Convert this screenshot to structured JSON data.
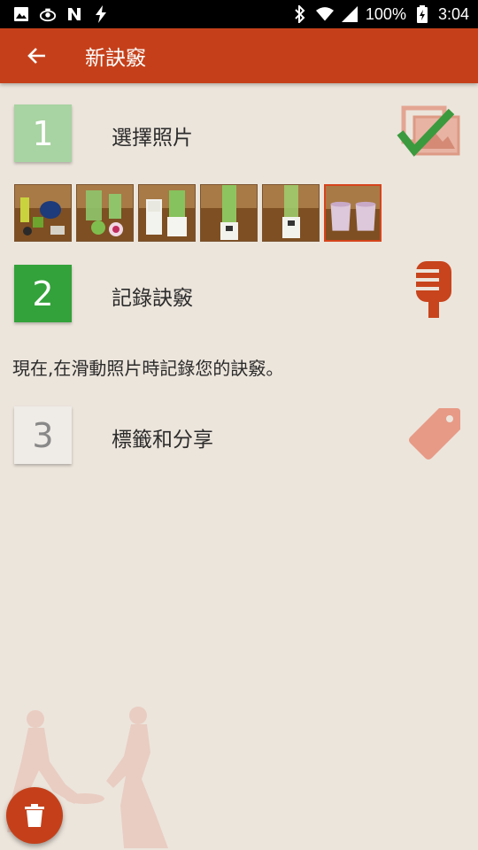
{
  "status_bar": {
    "battery_text": "100%",
    "time": "3:04",
    "icons_left": [
      "image-icon",
      "cooking-pot-icon",
      "n-icon",
      "flash-icon"
    ],
    "icons_right": [
      "bluetooth-icon",
      "wifi-icon",
      "signal-icon",
      "battery-icon"
    ]
  },
  "app_bar": {
    "title": "新訣竅",
    "back_icon": "arrow-back-icon"
  },
  "steps": [
    {
      "number": "1",
      "label": "選擇照片",
      "icon": "photos-check-icon"
    },
    {
      "number": "2",
      "label": "記錄訣竅",
      "icon": "microphone-icon"
    },
    {
      "number": "3",
      "label": "標籤和分享",
      "icon": "tag-icon"
    }
  ],
  "thumbnails": [
    {
      "name": "thumb-1",
      "selected": false
    },
    {
      "name": "thumb-2",
      "selected": false
    },
    {
      "name": "thumb-3",
      "selected": false
    },
    {
      "name": "thumb-4",
      "selected": false
    },
    {
      "name": "thumb-5",
      "selected": false
    },
    {
      "name": "thumb-6",
      "selected": true
    }
  ],
  "instruction": "現在,在滑動照片時記錄您的訣竅。",
  "fab": {
    "icon": "trash-icon"
  },
  "colors": {
    "primary": "#c5401a",
    "background": "#ece5dc",
    "step1_box": "#a8d3a2",
    "step2_box": "#33a23a",
    "step3_box": "#efebe6"
  }
}
